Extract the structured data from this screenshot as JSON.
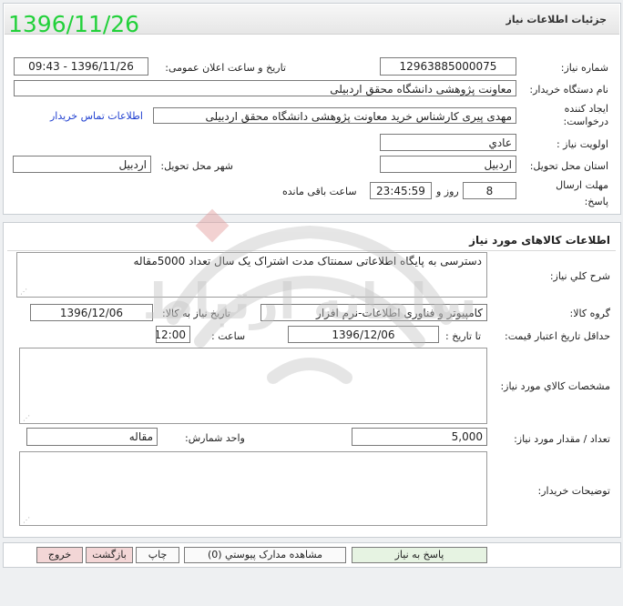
{
  "header": {
    "date_overlay": "1396/11/26",
    "title": "جزئیات اطلاعات نیاز"
  },
  "details": {
    "need_number_label": "شماره نیاز:",
    "need_number": "12963885000075",
    "announce_label": "تاریخ و ساعت اعلان عمومی:",
    "announce_value": "1396/11/26 - 09:43",
    "buyer_org_label": "نام دستگاه خریدار:",
    "buyer_org": "معاونت پژوهشی دانشگاه محقق اردبیلی",
    "creator_label": "ایجاد کننده درخواست:",
    "creator": "مهدی پیری کارشناس خرید معاونت پژوهشی دانشگاه محقق اردبیلی",
    "contact_link": "اطلاعات تماس خریدار",
    "priority_label": "اولویت نیاز :",
    "priority": "عادي",
    "province_label": "استان محل تحویل:",
    "province": "اردبیل",
    "city_label": "شهر محل تحویل:",
    "city": "اردبیل",
    "deadline_label": "مهلت ارسال پاسخ:",
    "days_value": "8",
    "days_word": "روز و",
    "time_remaining": "23:45:59",
    "remaining_text": "ساعت باقی مانده"
  },
  "goods": {
    "section_title": "اطلاعات کالاهای مورد نیاز",
    "summary_label": "شرح کلي نیاز:",
    "summary": "دسترسی به پایگاه اطلاعاتی سمنتاک مدت اشتراک یک سال تعداد 5000مقاله",
    "group_label": "گروه کالا:",
    "group": "کامپیوتر و فناوری اطلاعات-نرم افزار",
    "need_date_label": "تاریخ نیاز به کالا:",
    "need_date": "1396/12/06",
    "validity_label": "حداقل تاریخ اعتبار قیمت:",
    "until_label": "تا تاریخ :",
    "until_date": "1396/12/06",
    "time_label": "ساعت :",
    "time_value": "12:00",
    "specs_label": "مشخصات کالاي مورد نیاز:",
    "qty_label": "تعداد / مقدار مورد نیاز:",
    "qty": "5,000",
    "unit_label": "واحد شمارش:",
    "unit": "مقاله",
    "buyer_notes_label": "توضیحات خریدار:"
  },
  "buttons": {
    "reply": "پاسخ به نیاز",
    "attachments": "مشاهده مدارک پیوستي (0)",
    "print": "چاپ",
    "back": "بازگشت",
    "exit": "خروج"
  },
  "watermark": {
    "text": "سامانه ارتباط"
  },
  "colors": {
    "overlay_green": "#22d13a",
    "link_blue": "#1f3fd0",
    "reply_button_bg": "#e6f3e2",
    "back_button_bg": "#f3d6d6",
    "exit_button_bg": "#f3d6d6"
  }
}
